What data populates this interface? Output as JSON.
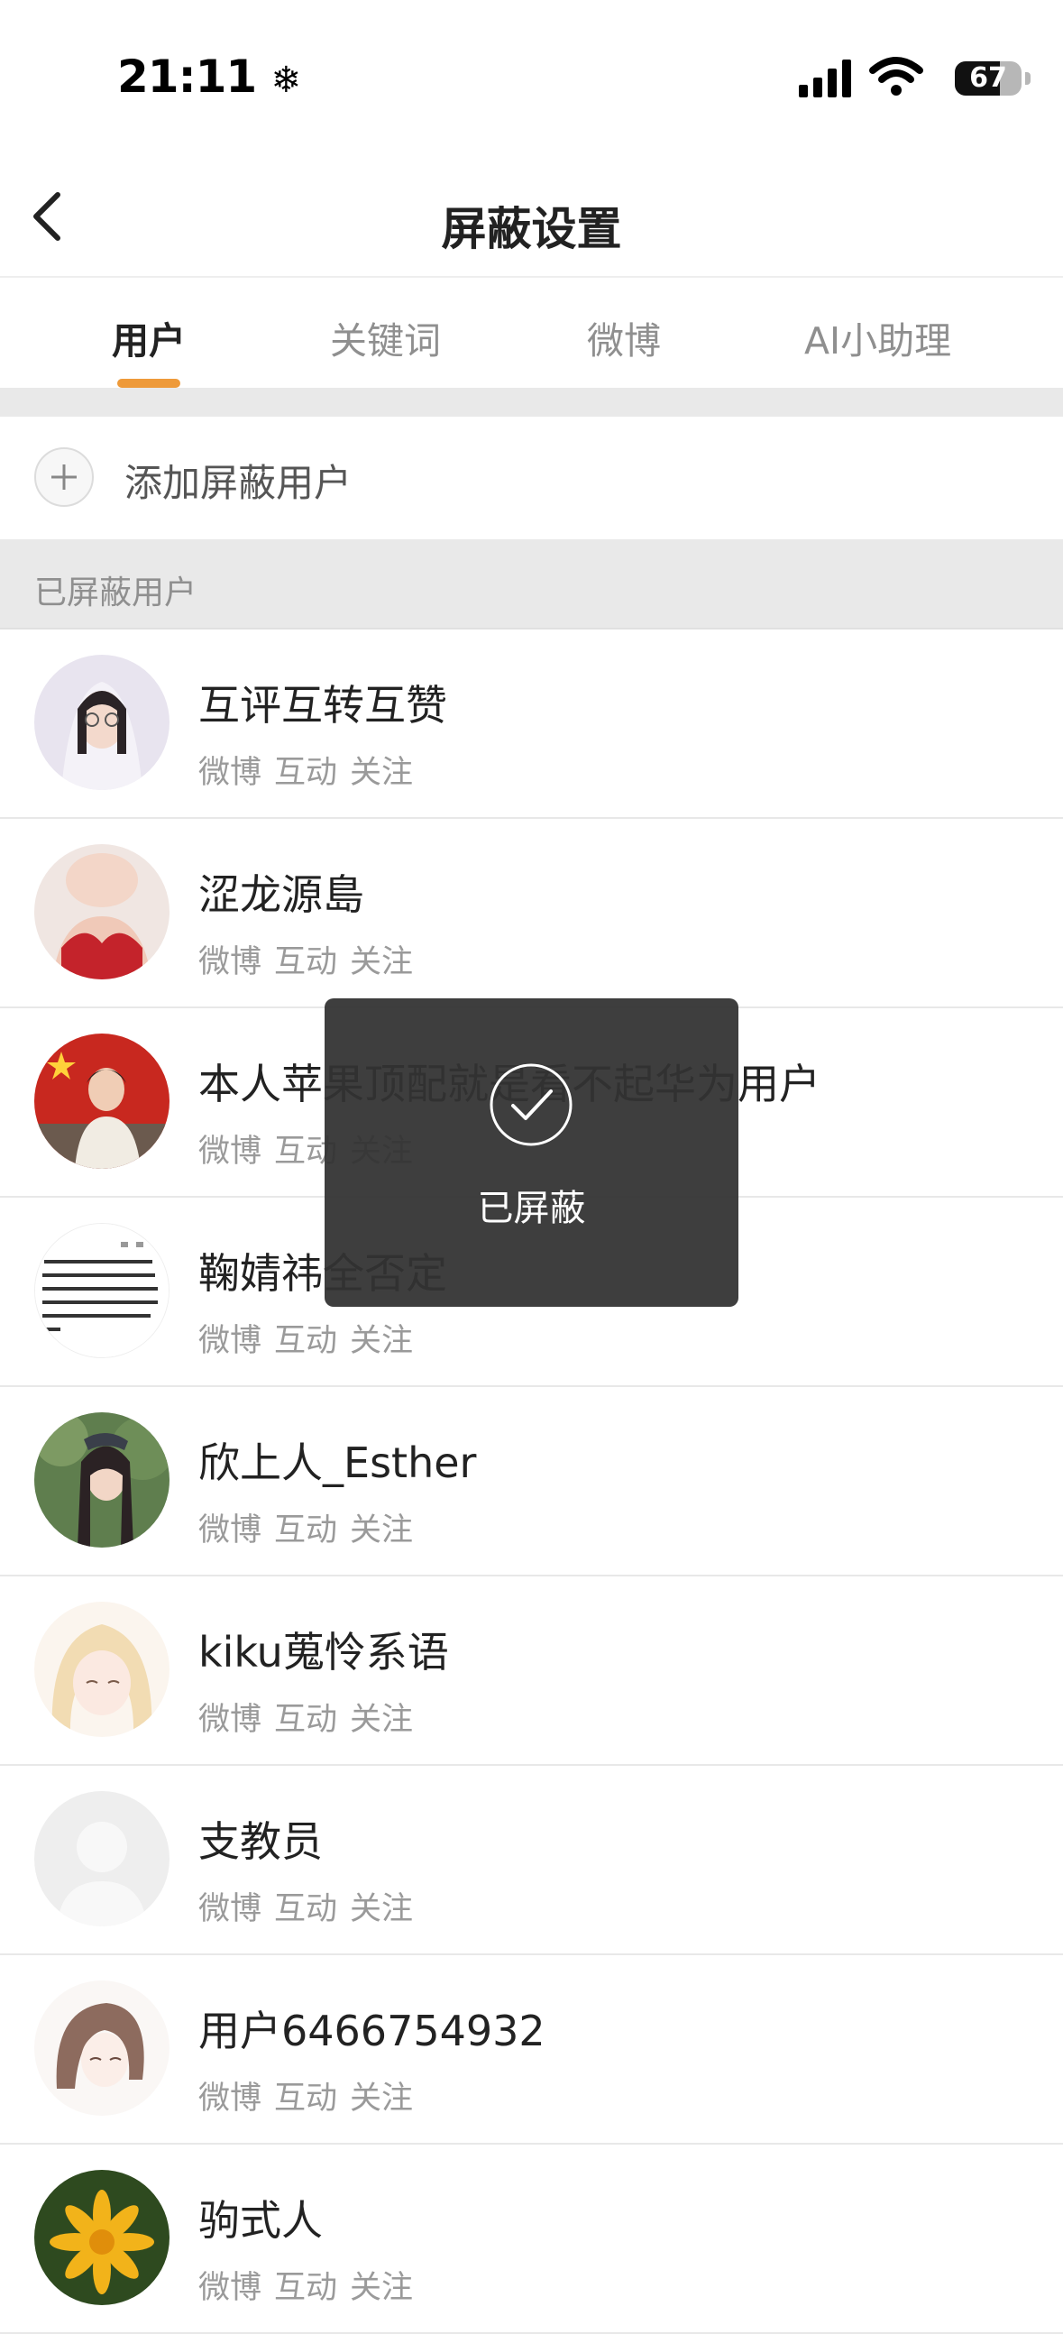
{
  "status_bar": {
    "time": "21:11",
    "time_icon": "snowflake-icon",
    "battery": "67",
    "battery_level": 0.67
  },
  "nav": {
    "title": "屏蔽设置",
    "back_icon": "chevron-left-icon"
  },
  "tabs": [
    {
      "label": "用户",
      "active": true
    },
    {
      "label": "关键词",
      "active": false
    },
    {
      "label": "微博",
      "active": false
    },
    {
      "label": "AI小助理",
      "active": false
    }
  ],
  "add_user": {
    "label": "添加屏蔽用户",
    "icon": "plus-icon"
  },
  "section": {
    "label": "已屏蔽用户"
  },
  "users": [
    {
      "name": "互评互转互赞",
      "meta": [
        "微博",
        "互动",
        "关注"
      ]
    },
    {
      "name": "涩龙源島",
      "meta": [
        "微博",
        "互动",
        "关注"
      ]
    },
    {
      "name": "本人苹果顶配就是看不起华为用户",
      "meta": [
        "微博",
        "互动",
        "关注"
      ]
    },
    {
      "name": "鞠婧祎全否定",
      "meta": [
        "微博",
        "互动",
        "关注"
      ]
    },
    {
      "name": "欣上人_Esther",
      "meta": [
        "微博",
        "互动",
        "关注"
      ]
    },
    {
      "name": "kiku蒐怜系语",
      "meta": [
        "微博",
        "互动",
        "关注"
      ]
    },
    {
      "name": "支教员",
      "meta": [
        "微博",
        "互动",
        "关注"
      ]
    },
    {
      "name": "用户6466754932",
      "meta": [
        "微博",
        "互动",
        "关注"
      ]
    },
    {
      "name": "驹式人",
      "meta": [
        "微博",
        "互动",
        "关注"
      ]
    }
  ],
  "toast": {
    "text": "已屏蔽",
    "icon": "check-circle-icon"
  },
  "colors": {
    "accent": "#ee9a3a",
    "toast_bg": "#333333",
    "section_bg": "#e9e9e9"
  }
}
